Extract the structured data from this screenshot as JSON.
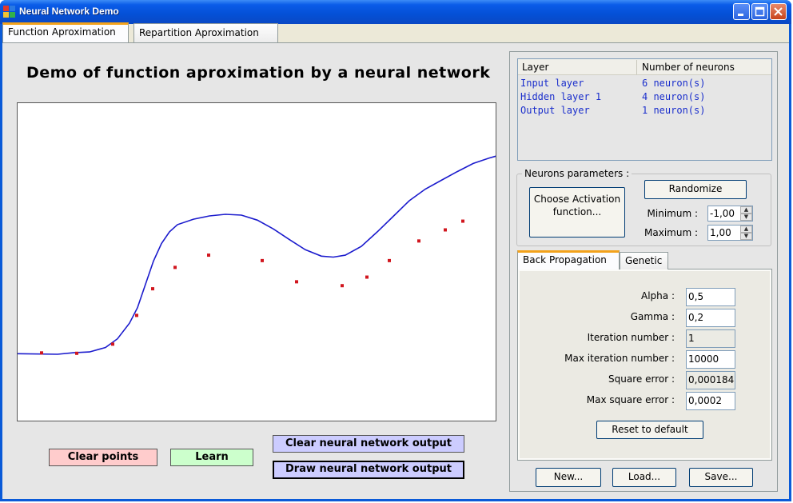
{
  "window": {
    "title": "Neural Network Demo"
  },
  "tabs": [
    {
      "label": "Function Aproximation",
      "active": true
    },
    {
      "label": "Repartition Aproximation",
      "active": false
    }
  ],
  "main": {
    "title": "Demo of function aproximation by a neural network",
    "buttons": {
      "clear_points": "Clear points",
      "learn": "Learn",
      "clear_output": "Clear neural network output",
      "draw_output": "Draw neural network output"
    }
  },
  "colors": {
    "curve": "#1c1ccd",
    "points": "#d1161e",
    "clear_points_bg": "#ffcccc",
    "learn_bg": "#ccffcc",
    "nn_buttons_bg": "#ccccff"
  },
  "plot_data": {
    "curve": [
      [
        0,
        0.003
      ],
      [
        50,
        0.0
      ],
      [
        70,
        0.008
      ],
      [
        90,
        0.012
      ],
      [
        110,
        0.035
      ],
      [
        125,
        0.08
      ],
      [
        140,
        0.16
      ],
      [
        150,
        0.24
      ],
      [
        160,
        0.36
      ],
      [
        170,
        0.48
      ],
      [
        180,
        0.57
      ],
      [
        190,
        0.63
      ],
      [
        200,
        0.667
      ],
      [
        220,
        0.695
      ],
      [
        240,
        0.712
      ],
      [
        260,
        0.72
      ],
      [
        280,
        0.716
      ],
      [
        300,
        0.69
      ],
      [
        320,
        0.645
      ],
      [
        340,
        0.59
      ],
      [
        360,
        0.538
      ],
      [
        380,
        0.505
      ],
      [
        395,
        0.5
      ],
      [
        410,
        0.51
      ],
      [
        430,
        0.555
      ],
      [
        450,
        0.63
      ],
      [
        470,
        0.71
      ],
      [
        490,
        0.79
      ],
      [
        510,
        0.85
      ],
      [
        530,
        0.895
      ],
      [
        550,
        0.94
      ],
      [
        570,
        0.982
      ],
      [
        590,
        1.01
      ],
      [
        599,
        1.02
      ]
    ],
    "points": [
      [
        30,
        0.007
      ],
      [
        74,
        0.005
      ],
      [
        119,
        0.052
      ],
      [
        149,
        0.2
      ],
      [
        169,
        0.337
      ],
      [
        197,
        0.447
      ],
      [
        239,
        0.51
      ],
      [
        306,
        0.482
      ],
      [
        349,
        0.373
      ],
      [
        406,
        0.353
      ],
      [
        437,
        0.397
      ],
      [
        465,
        0.482
      ],
      [
        502,
        0.583
      ],
      [
        535,
        0.64
      ],
      [
        557,
        0.685
      ]
    ]
  },
  "layers": {
    "headers": [
      "Layer",
      "Number of neurons"
    ],
    "rows": [
      {
        "name": "Input layer",
        "count": "6 neuron(s)"
      },
      {
        "name": "Hidden layer 1",
        "count": "4 neuron(s)"
      },
      {
        "name": "Output layer",
        "count": "1 neuron(s)"
      }
    ]
  },
  "neurons": {
    "group_title": "Neurons parameters :",
    "choose_activation": "Choose Activation function...",
    "randomize": "Randomize",
    "minimum_label": "Minimum :",
    "minimum_value": "-1,00",
    "maximum_label": "Maximum :",
    "maximum_value": "1,00"
  },
  "training_tabs": [
    {
      "label": "Back Propagation",
      "active": true
    },
    {
      "label": "Genetic",
      "active": false
    }
  ],
  "backprop": {
    "alpha_label": "Alpha :",
    "alpha_value": "0,5",
    "gamma_label": "Gamma :",
    "gamma_value": "0,2",
    "iteration_label": "Iteration number :",
    "iteration_value": "1",
    "max_iteration_label": "Max iteration number :",
    "max_iteration_value": "10000",
    "square_error_label": "Square error :",
    "square_error_value": "0,000184",
    "max_square_error_label": "Max square error :",
    "max_square_error_value": "0,0002",
    "reset": "Reset to default"
  },
  "file_buttons": {
    "new": "New...",
    "load": "Load...",
    "save": "Save..."
  }
}
